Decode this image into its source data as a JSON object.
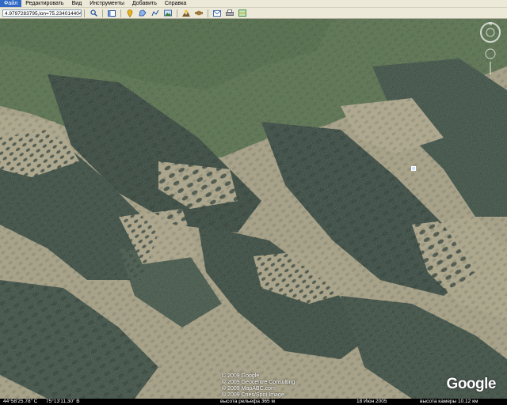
{
  "menu": {
    "items": [
      "Файл",
      "Редактировать",
      "Вид",
      "Инструменты",
      "Добавить",
      "Справка"
    ]
  },
  "toolbar": {
    "search_value": "4.9797283795,lon=75.2340144041",
    "icons": [
      "search-icon",
      "sidebar-toggle-icon",
      "placemark-icon",
      "polygon-icon",
      "path-icon",
      "image-overlay-icon",
      "sun-icon",
      "planets-icon",
      "email-icon",
      "print-icon",
      "view-in-maps-icon"
    ]
  },
  "map": {
    "copyright_lines": [
      "© 2009 Google",
      "© 2009 Geocentre Consulting",
      "© 2009 MapABC.com",
      "© 2009 Cnes/Spot Image"
    ],
    "logo_text": "Google"
  },
  "status": {
    "latitude": "44°58'25.78\" С",
    "longitude": "75°13'11.30\" В",
    "elevation": "высота рельефа 365 м",
    "imagery_date": "18 Июн 2005",
    "eye_altitude": "высота камеры   10.12 км"
  },
  "colors": {
    "toolbar_bg": "#ece9d8",
    "menu_active": "#316ac5",
    "terrain_light": "#a39c80",
    "terrain_dark": "#2c3e35",
    "terrain_green": "#4f6a45"
  }
}
